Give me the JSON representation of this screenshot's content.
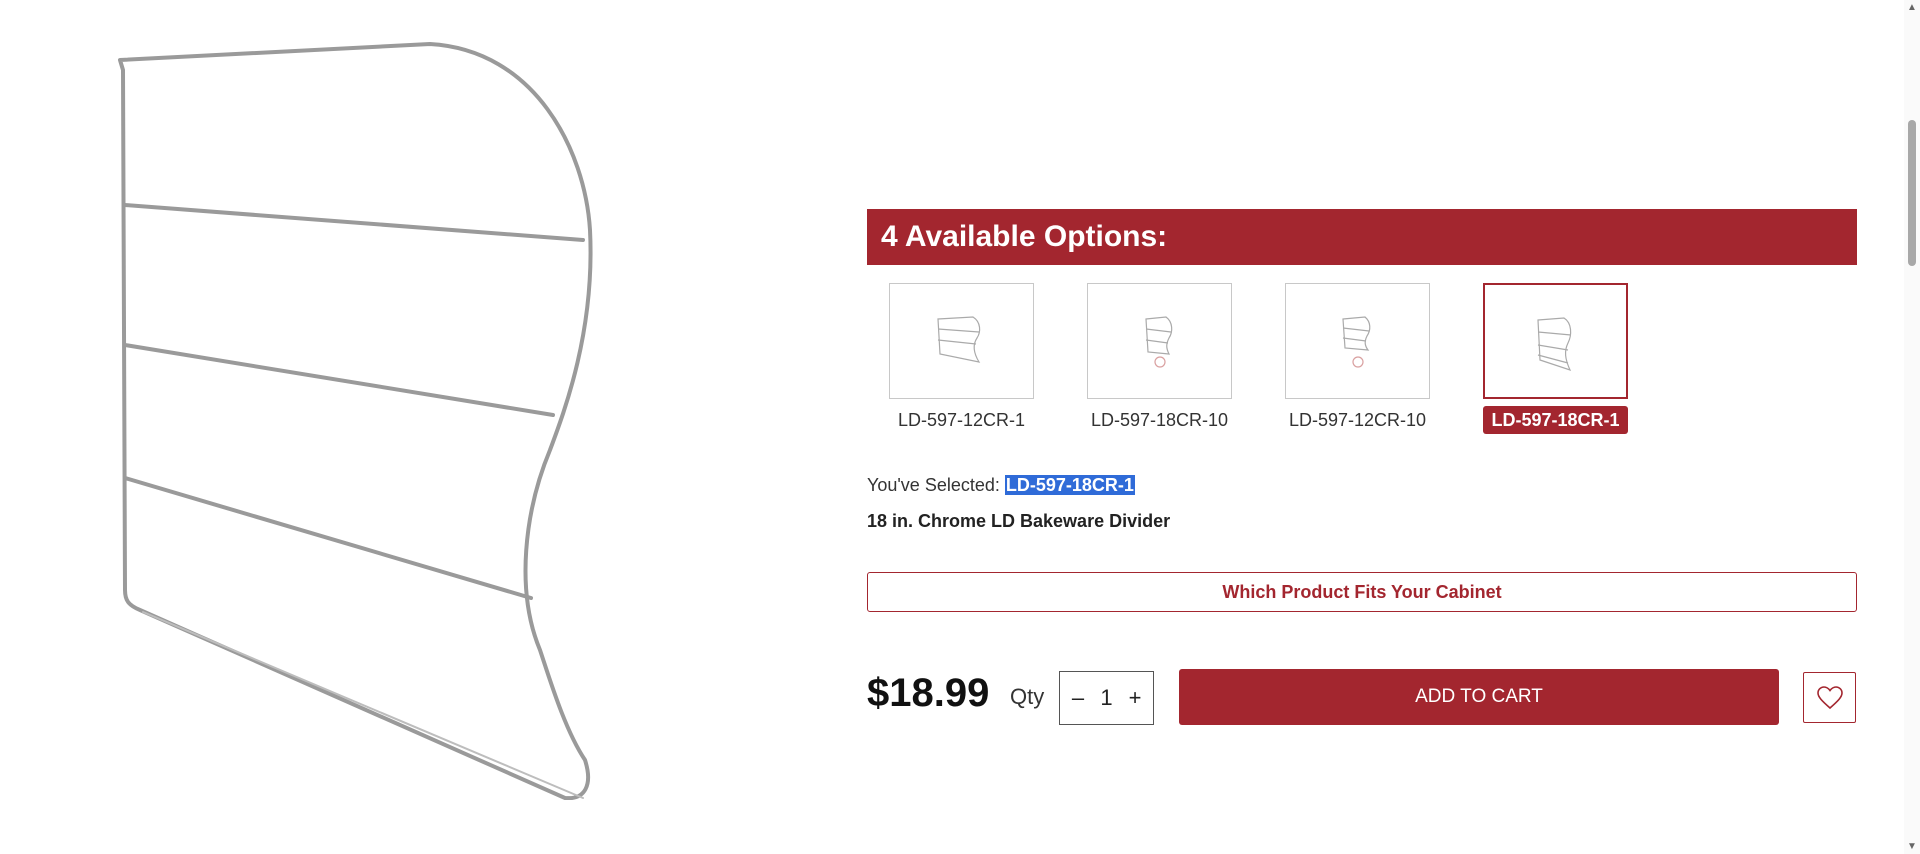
{
  "product": {
    "image_alt_icon": "chrome-wire-bakeware-divider-image"
  },
  "options": {
    "header": "4 Available Options:",
    "items": [
      {
        "label": "LD-597-12CR-1",
        "selected": false
      },
      {
        "label": "LD-597-18CR-10",
        "selected": false
      },
      {
        "label": "LD-597-12CR-10",
        "selected": false
      },
      {
        "label": "LD-597-18CR-1",
        "selected": true
      }
    ]
  },
  "selection": {
    "prefix": "You've Selected: ",
    "value": "LD-597-18CR-1",
    "product_name": "18 in. Chrome LD Bakeware Divider"
  },
  "fit_button_label": "Which Product Fits Your Cabinet",
  "purchase": {
    "price": "$18.99",
    "qty_label": "Qty",
    "qty_value": "1",
    "minus": "–",
    "plus": "+",
    "add_to_cart": "ADD TO CART",
    "wishlist_icon": "heart-icon"
  },
  "colors": {
    "brand": "#a3262f",
    "highlight": "#2f6bd8"
  }
}
